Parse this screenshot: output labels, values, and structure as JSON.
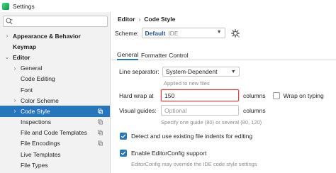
{
  "window": {
    "title": "Settings",
    "icon": "android-studio-icon"
  },
  "search": {
    "icon": "search-icon",
    "value": ""
  },
  "sidebar": {
    "items": [
      {
        "label": "Appearance & Behavior",
        "level": 0,
        "expandable": true,
        "expanded": false,
        "bold": true
      },
      {
        "label": "Keymap",
        "level": 0,
        "expandable": false,
        "bold": true
      },
      {
        "label": "Editor",
        "level": 0,
        "expandable": true,
        "expanded": true,
        "bold": true
      },
      {
        "label": "General",
        "level": 1,
        "expandable": true,
        "expanded": false
      },
      {
        "label": "Code Editing",
        "level": 1,
        "expandable": false
      },
      {
        "label": "Font",
        "level": 1,
        "expandable": false
      },
      {
        "label": "Color Scheme",
        "level": 1,
        "expandable": true,
        "expanded": false
      },
      {
        "label": "Code Style",
        "level": 1,
        "expandable": true,
        "expanded": false,
        "selected": true,
        "copy_icon": true
      },
      {
        "label": "Inspections",
        "level": 1,
        "expandable": false,
        "copy_icon": true
      },
      {
        "label": "File and Code Templates",
        "level": 1,
        "expandable": false,
        "copy_icon": true
      },
      {
        "label": "File Encodings",
        "level": 1,
        "expandable": false,
        "copy_icon": true
      },
      {
        "label": "Live Templates",
        "level": 1,
        "expandable": false
      },
      {
        "label": "File Types",
        "level": 1,
        "expandable": false
      }
    ]
  },
  "breadcrumb": {
    "parent": "Editor",
    "separator": "›",
    "current": "Code Style"
  },
  "scheme": {
    "label": "Scheme:",
    "value_bold": "Default",
    "value_muted": "IDE"
  },
  "tabs": [
    {
      "label": "General",
      "active": true
    },
    {
      "label": "Formatter Control",
      "active": false
    }
  ],
  "line_separator": {
    "label": "Line separator:",
    "value": "System-Dependent",
    "hint": "Applied to new files"
  },
  "hard_wrap": {
    "label": "Hard wrap at",
    "value": "150",
    "unit": "columns",
    "wrap_on_typing_label": "Wrap on typing",
    "wrap_on_typing_checked": false
  },
  "visual_guides": {
    "label": "Visual guides:",
    "placeholder": "Optional",
    "unit": "columns",
    "hint": "Specify one guide (80) or several (80, 120)"
  },
  "detect_indents": {
    "label": "Detect and use existing file indents for editing",
    "checked": true
  },
  "editorconfig": {
    "label": "Enable EditorConfig support",
    "checked": true,
    "hint": "EditorConfig may override the IDE code style settings"
  },
  "colors": {
    "accent": "#2675bf",
    "error": "#e0433a",
    "sidebar_bg": "#f2f2f2",
    "hint": "#8c8c8c"
  }
}
